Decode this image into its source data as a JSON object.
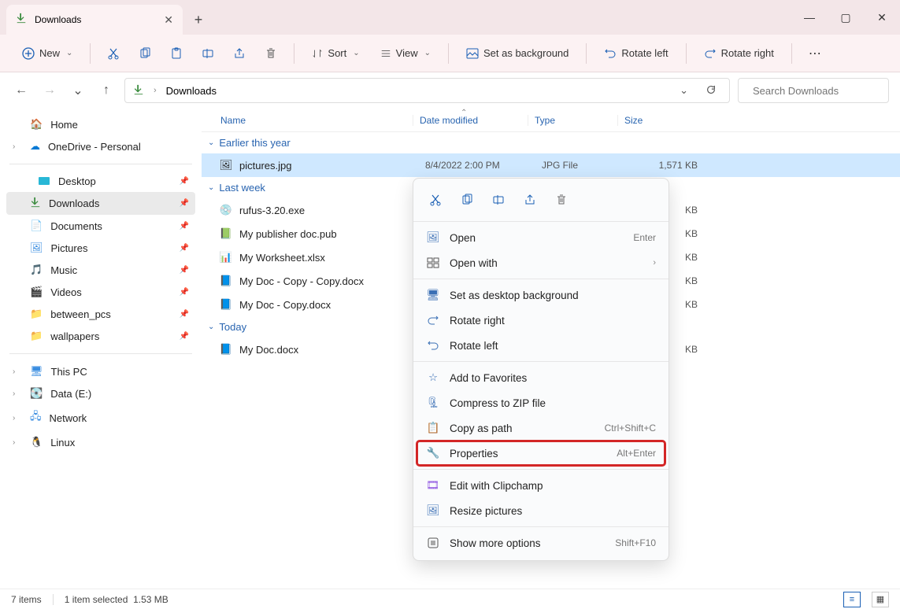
{
  "tab": {
    "title": "Downloads"
  },
  "toolbar": {
    "new": "New",
    "sort": "Sort",
    "view": "View",
    "set_bg": "Set as background",
    "rotate_left": "Rotate left",
    "rotate_right": "Rotate right"
  },
  "address": {
    "path": "Downloads"
  },
  "search": {
    "placeholder": "Search Downloads"
  },
  "sidebar": {
    "home": "Home",
    "onedrive": "OneDrive - Personal",
    "desktop": "Desktop",
    "downloads": "Downloads",
    "documents": "Documents",
    "pictures": "Pictures",
    "music": "Music",
    "videos": "Videos",
    "between": "between_pcs",
    "wallpapers": "wallpapers",
    "thispc": "This PC",
    "data": "Data (E:)",
    "network": "Network",
    "linux": "Linux"
  },
  "columns": {
    "name": "Name",
    "date": "Date modified",
    "type": "Type",
    "size": "Size"
  },
  "groups": {
    "earlier": "Earlier this year",
    "lastweek": "Last week",
    "today": "Today"
  },
  "files": {
    "pictures": {
      "name": "pictures.jpg",
      "date": "8/4/2022 2:00 PM",
      "type": "JPG File",
      "size": "1,571 KB"
    },
    "rufus": {
      "name": "rufus-3.20.exe",
      "size": "KB"
    },
    "publisher": {
      "name": "My publisher doc.pub",
      "size": "KB"
    },
    "worksheet": {
      "name": "My Worksheet.xlsx",
      "size": "KB"
    },
    "doccopy2": {
      "name": "My Doc - Copy - Copy.docx",
      "size": "KB"
    },
    "doccopy": {
      "name": "My Doc - Copy.docx",
      "size": "KB"
    },
    "doc": {
      "name": "My Doc.docx",
      "size": "KB"
    }
  },
  "context": {
    "open": "Open",
    "open_sc": "Enter",
    "openwith": "Open with",
    "setbg": "Set as desktop background",
    "rotr": "Rotate right",
    "rotl": "Rotate left",
    "fav": "Add to Favorites",
    "zip": "Compress to ZIP file",
    "copypath": "Copy as path",
    "copypath_sc": "Ctrl+Shift+C",
    "props": "Properties",
    "props_sc": "Alt+Enter",
    "clipchamp": "Edit with Clipchamp",
    "resize": "Resize pictures",
    "more": "Show more options",
    "more_sc": "Shift+F10"
  },
  "status": {
    "items": "7 items",
    "selected": "1 item selected",
    "size": "1.53 MB"
  }
}
